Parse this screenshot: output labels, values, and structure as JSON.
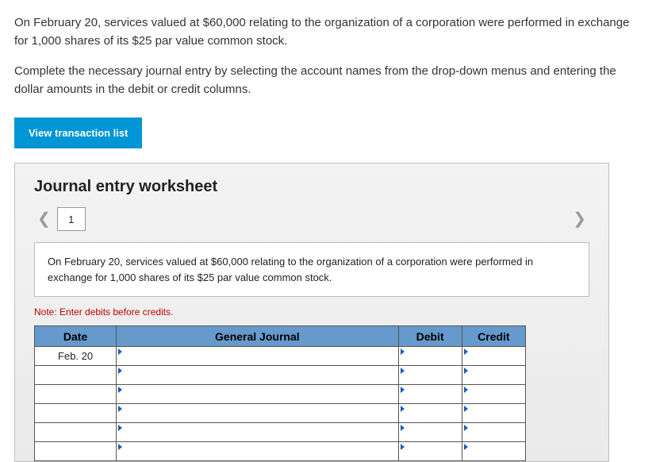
{
  "intro": {
    "p1": "On February 20, services valued at $60,000 relating to the organization of a corporation were performed in exchange for 1,000 shares of its $25 par value common stock.",
    "p2": "Complete the necessary journal entry by selecting the account names from the drop-down menus and entering the dollar amounts in the debit or credit columns."
  },
  "buttons": {
    "view_list": "View transaction list"
  },
  "worksheet": {
    "title": "Journal entry worksheet",
    "page_number": "1",
    "prompt": "On February 20, services valued at $60,000 relating to the organization of a corporation were performed in exchange for 1,000 shares of its $25 par value common stock.",
    "note": "Note: Enter debits before credits.",
    "headers": {
      "date": "Date",
      "general_journal": "General Journal",
      "debit": "Debit",
      "credit": "Credit"
    },
    "rows": [
      {
        "date": "Feb. 20",
        "gj": "",
        "debit": "",
        "credit": ""
      },
      {
        "date": "",
        "gj": "",
        "debit": "",
        "credit": ""
      },
      {
        "date": "",
        "gj": "",
        "debit": "",
        "credit": ""
      },
      {
        "date": "",
        "gj": "",
        "debit": "",
        "credit": ""
      },
      {
        "date": "",
        "gj": "",
        "debit": "",
        "credit": ""
      },
      {
        "date": "",
        "gj": "",
        "debit": "",
        "credit": ""
      }
    ]
  }
}
